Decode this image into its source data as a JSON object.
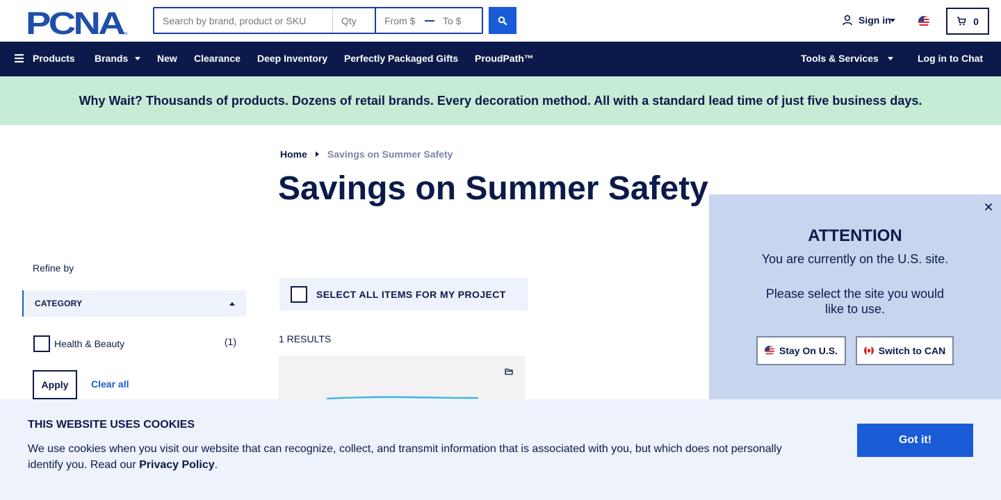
{
  "brand": {
    "logo_text": "PCNA",
    "logo_tm": "TM"
  },
  "colors": {
    "navy": "#0b1a4a",
    "accent_blue": "#1a5bd8",
    "promo_green": "#c6ecd5",
    "panel_blue": "#c7d6ee",
    "light_blue": "#edf2fb"
  },
  "search": {
    "main_placeholder": "Search by brand, product or SKU",
    "qty_placeholder": "Qty",
    "from_placeholder": "From $",
    "to_placeholder": "To $",
    "button_icon": "search-icon"
  },
  "header": {
    "signin_label": "Sign in",
    "cart_count": "0"
  },
  "nav": {
    "products": "Products",
    "brands": "Brands",
    "new": "New",
    "clearance": "Clearance",
    "deep_inventory": "Deep Inventory",
    "packaged_gifts": "Perfectly Packaged Gifts",
    "proudpath": "ProudPath™",
    "tools": "Tools & Services",
    "chat": "Log in to Chat"
  },
  "promo": {
    "text": "Why Wait? Thousands of products. Dozens of retail brands. Every decoration method. All with a standard lead time of just five business days."
  },
  "breadcrumb": {
    "home": "Home",
    "current": "Savings on Summer Safety"
  },
  "page": {
    "title": "Savings on Summer Safety"
  },
  "sidebar": {
    "refine_label": "Refine by",
    "category_heading": "CATEGORY",
    "facets": [
      {
        "label": "Health & Beauty",
        "count": "(1)"
      }
    ],
    "apply_label": "Apply",
    "clear_label": "Clear all"
  },
  "results": {
    "select_all_label": "SELECT ALL ITEMS FOR MY PROJECT",
    "count_label": "1 RESULTS"
  },
  "attention": {
    "title": "ATTENTION",
    "line1": "You are currently on the U.S. site.",
    "line2": "Please select the site you would like to use.",
    "stay_label": "Stay On U.S.",
    "switch_label": "Switch to CAN"
  },
  "cookie": {
    "title": "THIS WEBSITE USES COOKIES",
    "text_before": "We use cookies when you visit our website that can recognize, collect, and transmit information that is associated with you, but which does not personally identify you. Read our ",
    "link": "Privacy Policy",
    "text_after": ".",
    "button": "Got it!"
  }
}
